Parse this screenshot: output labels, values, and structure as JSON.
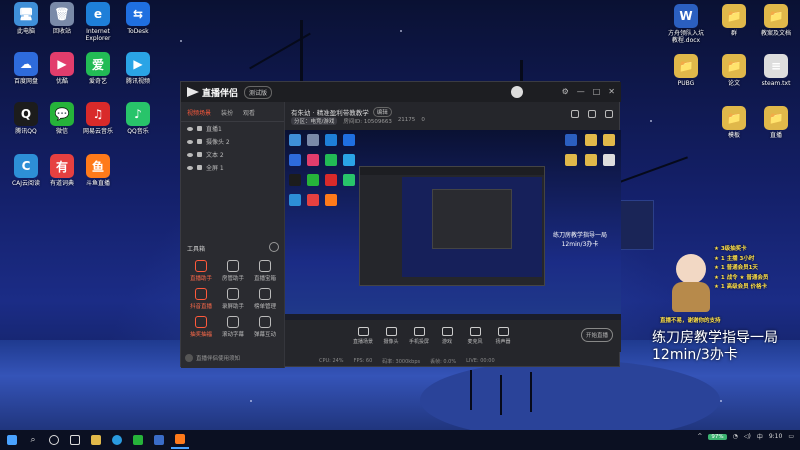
{
  "desktop": {
    "icons_left": [
      {
        "label": "此电脑",
        "glyph": "🖥",
        "color": "#3f8fd8"
      },
      {
        "label": "回收站",
        "glyph": "🗑",
        "color": "#7a8aa8"
      },
      {
        "label": "Internet\nExplorer",
        "glyph": "e",
        "color": "#1e7fd8"
      },
      {
        "label": "ToDesk",
        "glyph": "⇆",
        "color": "#1f6fe0"
      },
      {
        "label": "百度网盘",
        "glyph": "☁",
        "color": "#2e6bdc"
      },
      {
        "label": "优酷",
        "glyph": "▶",
        "color": "#e23d6c"
      },
      {
        "label": "爱奇艺",
        "glyph": "爱",
        "color": "#22bb55"
      },
      {
        "label": "腾讯视频",
        "glyph": "▶",
        "color": "#2aa4e6"
      },
      {
        "label": "腾讯QQ",
        "glyph": "Q",
        "color": "#1c1c1c"
      },
      {
        "label": "微信",
        "glyph": "💬",
        "color": "#26b33a"
      },
      {
        "label": "网易云音乐",
        "glyph": "♫",
        "color": "#d92a2a"
      },
      {
        "label": "QQ音乐",
        "glyph": "♪",
        "color": "#28c46a"
      },
      {
        "label": "CAJ云阅读",
        "glyph": "C",
        "color": "#2d8fd6"
      },
      {
        "label": "有道词典",
        "glyph": "有",
        "color": "#e64040"
      },
      {
        "label": "斗鱼直播",
        "glyph": "鱼",
        "color": "#ff7a1a"
      }
    ],
    "icons_right": [
      {
        "label": "方舟领队入坑\n教程.docx",
        "glyph": "W",
        "color": "#2b5fc0"
      },
      {
        "label": "群",
        "glyph": "📁",
        "color": "#e0b84a"
      },
      {
        "label": "教案及文档",
        "glyph": "📁",
        "color": "#e0b84a"
      },
      {
        "label": "PUBG",
        "glyph": "📁",
        "color": "#e0b84a"
      },
      {
        "label": "论文",
        "glyph": "📁",
        "color": "#e0b84a"
      },
      {
        "label": "steam.txt",
        "glyph": "≡",
        "color": "#dddddd"
      },
      {
        "label": "模板",
        "glyph": "📁",
        "color": "#e0b84a"
      },
      {
        "label": "直播",
        "glyph": "📁",
        "color": "#e0b84a"
      }
    ]
  },
  "app": {
    "name": "直播伴侣",
    "edition_pill": "测试版",
    "left_tabs": [
      "视频场景",
      "装扮",
      "观看"
    ],
    "scenes": [
      "直播1",
      "摄像头 2",
      "文本 2",
      "全屏 1"
    ],
    "tools_header": "工具箱",
    "tools": [
      {
        "label": "直播助手",
        "red": true
      },
      {
        "label": "房管助手",
        "red": false
      },
      {
        "label": "直播宝箱",
        "red": false
      },
      {
        "label": "抖音直播",
        "red": true
      },
      {
        "label": "录屏助手",
        "red": false
      },
      {
        "label": "榜单管理",
        "red": false
      },
      {
        "label": "抽奖抽福",
        "red": true
      },
      {
        "label": "滚动字幕",
        "red": false
      },
      {
        "label": "弹幕互动",
        "red": false
      }
    ],
    "notice": "直播伴侣使用须知",
    "stream_title": "有朱幼 · 精准盈利带教教学",
    "stream_tag": "编辑",
    "stream_info": [
      "分区：电竞/游戏",
      "房间ID: 10509663",
      "21175",
      "0"
    ],
    "overlay_text": "练刀房教学指导一局\n12min/3办卡",
    "controls": [
      "直播场景",
      "摄像头",
      "手机投屏",
      "游戏",
      "麦克风",
      "扬声器"
    ],
    "start_button": "开始直播",
    "status": [
      "CPU: 24%",
      "FPS: 60",
      "码率: 3000kbps",
      "丢帧: 0.0%",
      "LIVE: 00:00"
    ]
  },
  "stream_overlay": {
    "caption": "练刀房教学指导一局\n12min/3办卡",
    "promo_lines": [
      "★ 3级抽奖卡",
      "★ 1 主播 3小时",
      "★ 1 普通会员1天",
      "★ 1 战令 ★ 普通会员",
      "★ 1 高级会员 价格卡"
    ],
    "promo_bottom": "直播不易，谢谢你的支持"
  },
  "taskbar": {
    "apps": [
      "start",
      "search",
      "task-view",
      "file-explorer",
      "edge",
      "weixin",
      "store",
      "live-companion"
    ],
    "battery": "97%",
    "tray_lang": "中",
    "time": "9:10"
  }
}
